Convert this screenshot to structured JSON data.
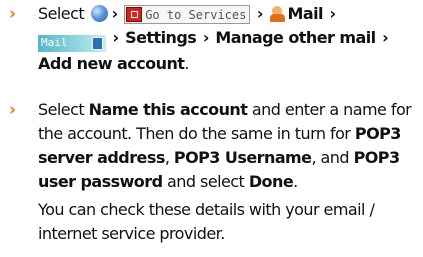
{
  "bullet_glyph": "›",
  "separator": "›",
  "step1": {
    "select": "Select",
    "goto_services": "Go to Services",
    "mail": "Mail",
    "mail_bar_label": "Mail",
    "settings": "Settings",
    "manage_other_mail": "Manage other mail",
    "add_new_account": "Add new account",
    "end": "."
  },
  "step2": {
    "select": "Select",
    "name_this_account": "Name this account",
    "t1": "and enter a name for the account. Then do the same in turn for",
    "pop3_server_address": "POP3 server address",
    "comma1": ",",
    "pop3_username": "POP3 Username",
    "and": ", and",
    "pop3_user_password": "POP3 user password",
    "and_select": "and select",
    "done": "Done",
    "end": "."
  },
  "note": "You can check these details with your email / internet service provider.",
  "colors": {
    "bullet": "#f07c00",
    "mail_bar": "#56b5c7",
    "goto_icon": "#d8231c"
  }
}
